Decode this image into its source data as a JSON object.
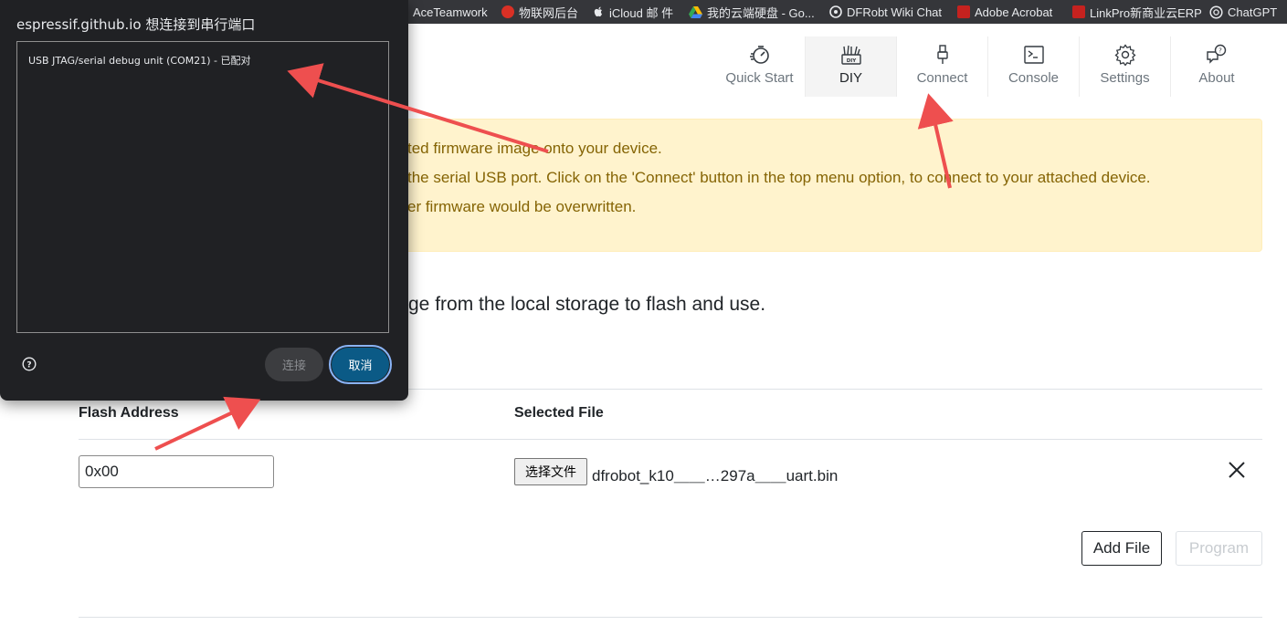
{
  "bookmarks": [
    {
      "label": "AceTeamwork",
      "icon": "aceteamwork-icon",
      "color": "#35363a"
    },
    {
      "label": "物联网后台",
      "icon": "iot-backend-icon",
      "color": "#d93025"
    },
    {
      "label": "iCloud 邮 件",
      "icon": "apple-icon",
      "color": "#e8eaed"
    },
    {
      "label": "我的云端硬盘 - Go...",
      "icon": "google-drive-icon",
      "color": "#fbbc04"
    },
    {
      "label": "DFRobt Wiki Chat",
      "icon": "dfrobot-icon",
      "color": "#e8eaed"
    },
    {
      "label": "Adobe Acrobat",
      "icon": "adobe-acrobat-icon",
      "color": "#c5221f"
    },
    {
      "label": "LinkPro新商业云ERP",
      "icon": "linkpro-icon",
      "color": "#c5221f"
    },
    {
      "label": "ChatGPT",
      "icon": "chatgpt-icon",
      "color": "#e8eaed"
    }
  ],
  "nav": [
    {
      "label": "Quick Start",
      "icon": "quick-start-icon",
      "active": false
    },
    {
      "label": "DIY",
      "icon": "diy-icon",
      "active": true
    },
    {
      "label": "Connect",
      "icon": "usb-plug-icon",
      "active": false
    },
    {
      "label": "Console",
      "icon": "terminal-icon",
      "active": false
    },
    {
      "label": "Settings",
      "icon": "gear-icon",
      "active": false
    },
    {
      "label": "About",
      "icon": "chat-question-icon",
      "active": false
    }
  ],
  "alert": {
    "line1": "ted firmware image onto your device.",
    "line2": "the serial USB port. Click on the 'Connect' button in the top menu option, to connect to your attached device.",
    "line3": "er firmware would be overwritten."
  },
  "lead_text": "ge from the local storage to flash and use.",
  "table": {
    "col_address": "Flash Address",
    "col_file": "Selected File",
    "rows": [
      {
        "address": "0x00",
        "choose_label": "选择文件",
        "file_name": "dfrobot_k10＿＿…297a＿＿uart.bin"
      }
    ]
  },
  "buttons": {
    "add_file": "Add File",
    "program": "Program"
  },
  "dialog": {
    "title": "espressif.github.io 想连接到串行端口",
    "port": "USB JTAG/serial debug unit (COM21) - 已配对",
    "connect": "连接",
    "cancel": "取消"
  },
  "colors": {
    "alert_bg": "#fff3cd",
    "alert_text": "#856404",
    "dialog_bg": "#202124",
    "annotation_arrow": "#ee4f4f"
  }
}
